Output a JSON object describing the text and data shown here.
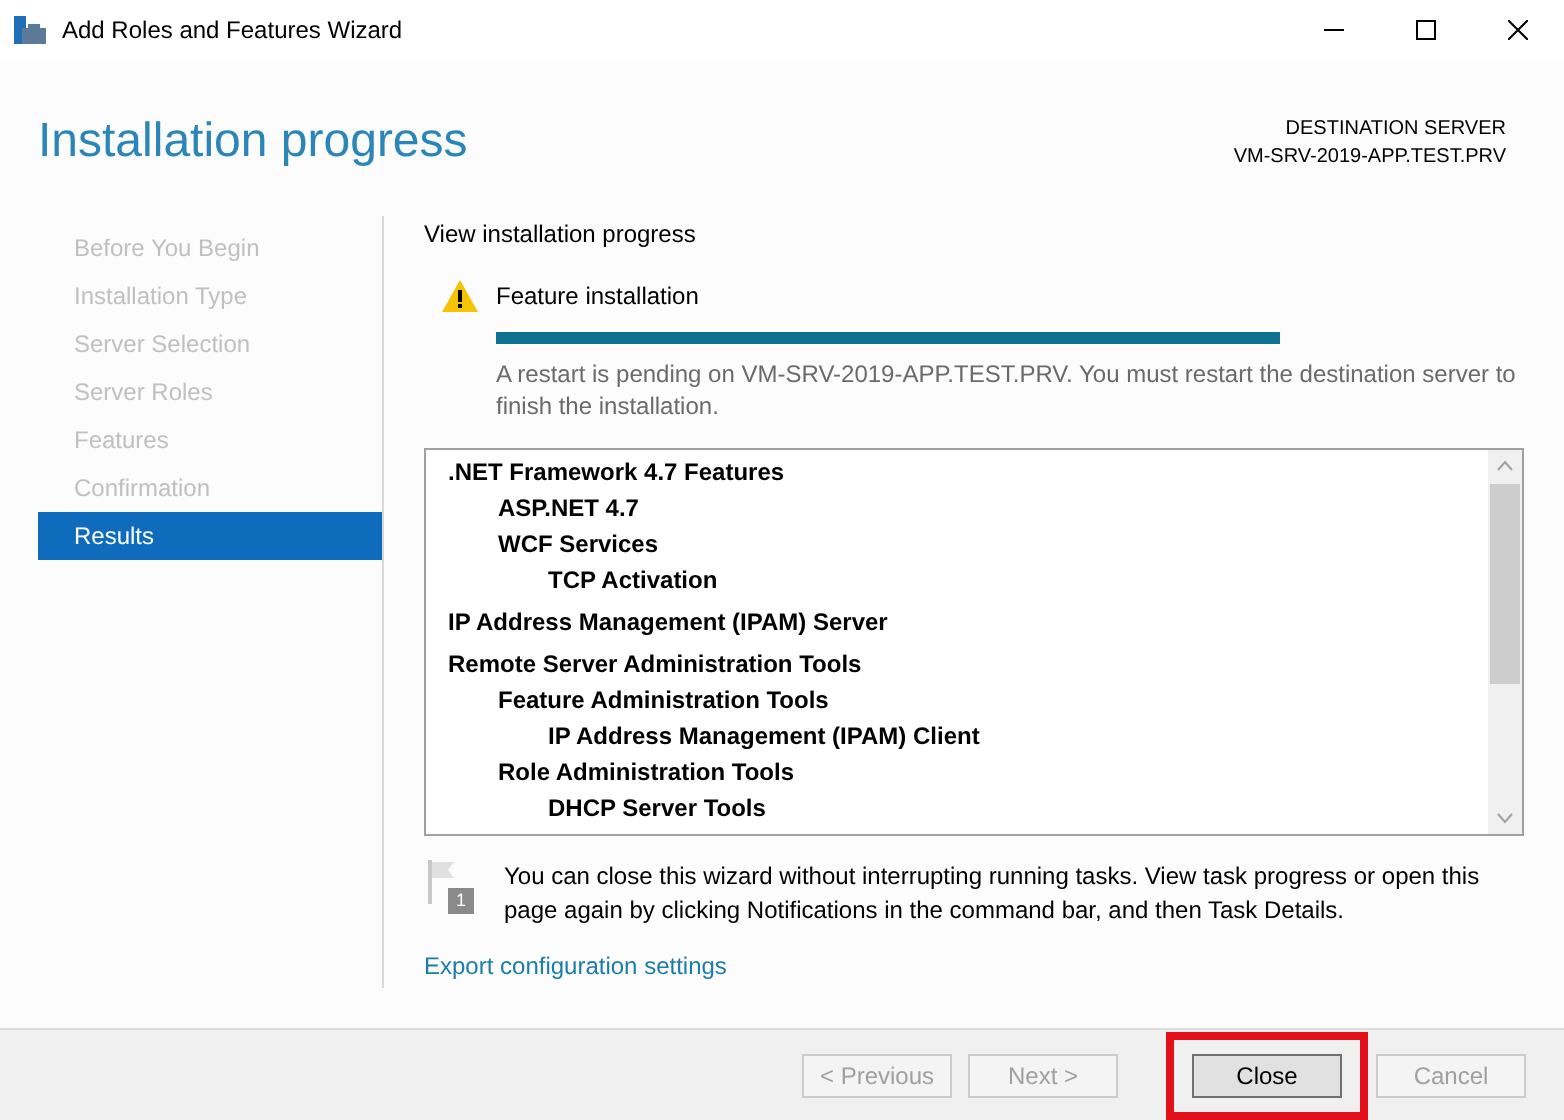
{
  "window": {
    "title": "Add Roles and Features Wizard"
  },
  "header": {
    "title": "Installation progress",
    "server_label": "DESTINATION SERVER",
    "server_name": "VM-SRV-2019-APP.TEST.PRV"
  },
  "nav": [
    {
      "label": "Before You Begin",
      "selected": false,
      "disabled": true
    },
    {
      "label": "Installation Type",
      "selected": false,
      "disabled": true
    },
    {
      "label": "Server Selection",
      "selected": false,
      "disabled": true
    },
    {
      "label": "Server Roles",
      "selected": false,
      "disabled": true
    },
    {
      "label": "Features",
      "selected": false,
      "disabled": true
    },
    {
      "label": "Confirmation",
      "selected": false,
      "disabled": true
    },
    {
      "label": "Results",
      "selected": true,
      "disabled": false
    }
  ],
  "content": {
    "heading": "View installation progress",
    "status": {
      "label": "Feature installation",
      "level": 1,
      "message": "A restart is pending on VM-SRV-2019-APP.TEST.PRV. You must restart the destination server to finish the installation."
    },
    "features": [
      {
        "label": ".NET Framework 4.7 Features",
        "children": [
          {
            "label": "ASP.NET 4.7"
          },
          {
            "label": "WCF Services",
            "children": [
              {
                "label": "TCP Activation"
              }
            ]
          }
        ]
      },
      {
        "label": "IP Address Management (IPAM) Server"
      },
      {
        "label": "Remote Server Administration Tools",
        "children": [
          {
            "label": "Feature Administration Tools",
            "children": [
              {
                "label": "IP Address Management (IPAM) Client"
              }
            ]
          },
          {
            "label": "Role Administration Tools",
            "children": [
              {
                "label": "DHCP Server Tools"
              }
            ]
          }
        ]
      }
    ],
    "notice": {
      "badge": "1",
      "text": "You can close this wizard without interrupting running tasks. View task progress or open this page again by clicking Notifications in the command bar, and then Task Details."
    },
    "export_link": "Export configuration settings"
  },
  "buttons": [
    {
      "label": "< Previous",
      "disabled": true,
      "highlighted": false
    },
    {
      "label": "Next >",
      "disabled": true,
      "highlighted": false
    },
    {
      "label": "Close",
      "disabled": false,
      "highlighted": true
    },
    {
      "label": "Cancel",
      "disabled": true,
      "highlighted": false
    }
  ]
}
